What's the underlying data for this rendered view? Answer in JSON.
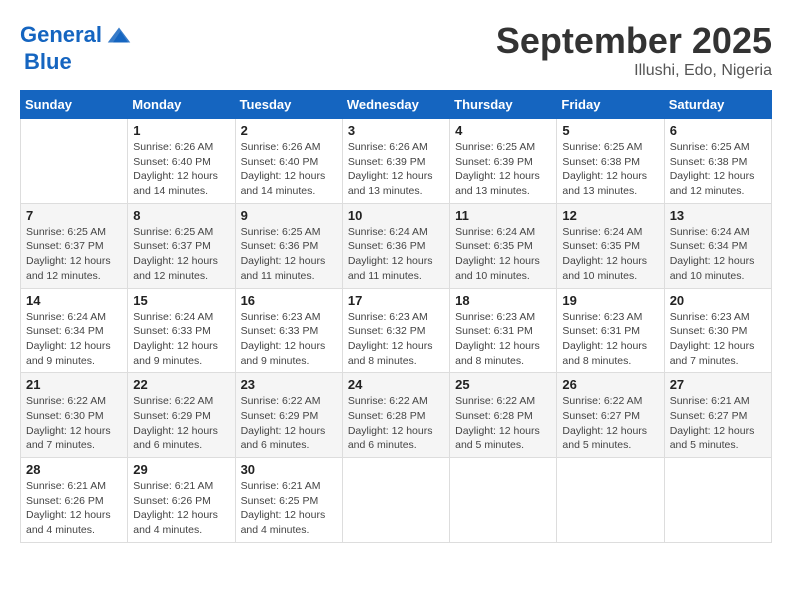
{
  "header": {
    "logo_line1": "General",
    "logo_line2": "Blue",
    "month_title": "September 2025",
    "location": "Illushi, Edo, Nigeria"
  },
  "weekdays": [
    "Sunday",
    "Monday",
    "Tuesday",
    "Wednesday",
    "Thursday",
    "Friday",
    "Saturday"
  ],
  "weeks": [
    [
      {
        "day": "",
        "info": ""
      },
      {
        "day": "1",
        "info": "Sunrise: 6:26 AM\nSunset: 6:40 PM\nDaylight: 12 hours\nand 14 minutes."
      },
      {
        "day": "2",
        "info": "Sunrise: 6:26 AM\nSunset: 6:40 PM\nDaylight: 12 hours\nand 14 minutes."
      },
      {
        "day": "3",
        "info": "Sunrise: 6:26 AM\nSunset: 6:39 PM\nDaylight: 12 hours\nand 13 minutes."
      },
      {
        "day": "4",
        "info": "Sunrise: 6:25 AM\nSunset: 6:39 PM\nDaylight: 12 hours\nand 13 minutes."
      },
      {
        "day": "5",
        "info": "Sunrise: 6:25 AM\nSunset: 6:38 PM\nDaylight: 12 hours\nand 13 minutes."
      },
      {
        "day": "6",
        "info": "Sunrise: 6:25 AM\nSunset: 6:38 PM\nDaylight: 12 hours\nand 12 minutes."
      }
    ],
    [
      {
        "day": "7",
        "info": "Sunrise: 6:25 AM\nSunset: 6:37 PM\nDaylight: 12 hours\nand 12 minutes."
      },
      {
        "day": "8",
        "info": "Sunrise: 6:25 AM\nSunset: 6:37 PM\nDaylight: 12 hours\nand 12 minutes."
      },
      {
        "day": "9",
        "info": "Sunrise: 6:25 AM\nSunset: 6:36 PM\nDaylight: 12 hours\nand 11 minutes."
      },
      {
        "day": "10",
        "info": "Sunrise: 6:24 AM\nSunset: 6:36 PM\nDaylight: 12 hours\nand 11 minutes."
      },
      {
        "day": "11",
        "info": "Sunrise: 6:24 AM\nSunset: 6:35 PM\nDaylight: 12 hours\nand 10 minutes."
      },
      {
        "day": "12",
        "info": "Sunrise: 6:24 AM\nSunset: 6:35 PM\nDaylight: 12 hours\nand 10 minutes."
      },
      {
        "day": "13",
        "info": "Sunrise: 6:24 AM\nSunset: 6:34 PM\nDaylight: 12 hours\nand 10 minutes."
      }
    ],
    [
      {
        "day": "14",
        "info": "Sunrise: 6:24 AM\nSunset: 6:34 PM\nDaylight: 12 hours\nand 9 minutes."
      },
      {
        "day": "15",
        "info": "Sunrise: 6:24 AM\nSunset: 6:33 PM\nDaylight: 12 hours\nand 9 minutes."
      },
      {
        "day": "16",
        "info": "Sunrise: 6:23 AM\nSunset: 6:33 PM\nDaylight: 12 hours\nand 9 minutes."
      },
      {
        "day": "17",
        "info": "Sunrise: 6:23 AM\nSunset: 6:32 PM\nDaylight: 12 hours\nand 8 minutes."
      },
      {
        "day": "18",
        "info": "Sunrise: 6:23 AM\nSunset: 6:31 PM\nDaylight: 12 hours\nand 8 minutes."
      },
      {
        "day": "19",
        "info": "Sunrise: 6:23 AM\nSunset: 6:31 PM\nDaylight: 12 hours\nand 8 minutes."
      },
      {
        "day": "20",
        "info": "Sunrise: 6:23 AM\nSunset: 6:30 PM\nDaylight: 12 hours\nand 7 minutes."
      }
    ],
    [
      {
        "day": "21",
        "info": "Sunrise: 6:22 AM\nSunset: 6:30 PM\nDaylight: 12 hours\nand 7 minutes."
      },
      {
        "day": "22",
        "info": "Sunrise: 6:22 AM\nSunset: 6:29 PM\nDaylight: 12 hours\nand 6 minutes."
      },
      {
        "day": "23",
        "info": "Sunrise: 6:22 AM\nSunset: 6:29 PM\nDaylight: 12 hours\nand 6 minutes."
      },
      {
        "day": "24",
        "info": "Sunrise: 6:22 AM\nSunset: 6:28 PM\nDaylight: 12 hours\nand 6 minutes."
      },
      {
        "day": "25",
        "info": "Sunrise: 6:22 AM\nSunset: 6:28 PM\nDaylight: 12 hours\nand 5 minutes."
      },
      {
        "day": "26",
        "info": "Sunrise: 6:22 AM\nSunset: 6:27 PM\nDaylight: 12 hours\nand 5 minutes."
      },
      {
        "day": "27",
        "info": "Sunrise: 6:21 AM\nSunset: 6:27 PM\nDaylight: 12 hours\nand 5 minutes."
      }
    ],
    [
      {
        "day": "28",
        "info": "Sunrise: 6:21 AM\nSunset: 6:26 PM\nDaylight: 12 hours\nand 4 minutes."
      },
      {
        "day": "29",
        "info": "Sunrise: 6:21 AM\nSunset: 6:26 PM\nDaylight: 12 hours\nand 4 minutes."
      },
      {
        "day": "30",
        "info": "Sunrise: 6:21 AM\nSunset: 6:25 PM\nDaylight: 12 hours\nand 4 minutes."
      },
      {
        "day": "",
        "info": ""
      },
      {
        "day": "",
        "info": ""
      },
      {
        "day": "",
        "info": ""
      },
      {
        "day": "",
        "info": ""
      }
    ]
  ]
}
